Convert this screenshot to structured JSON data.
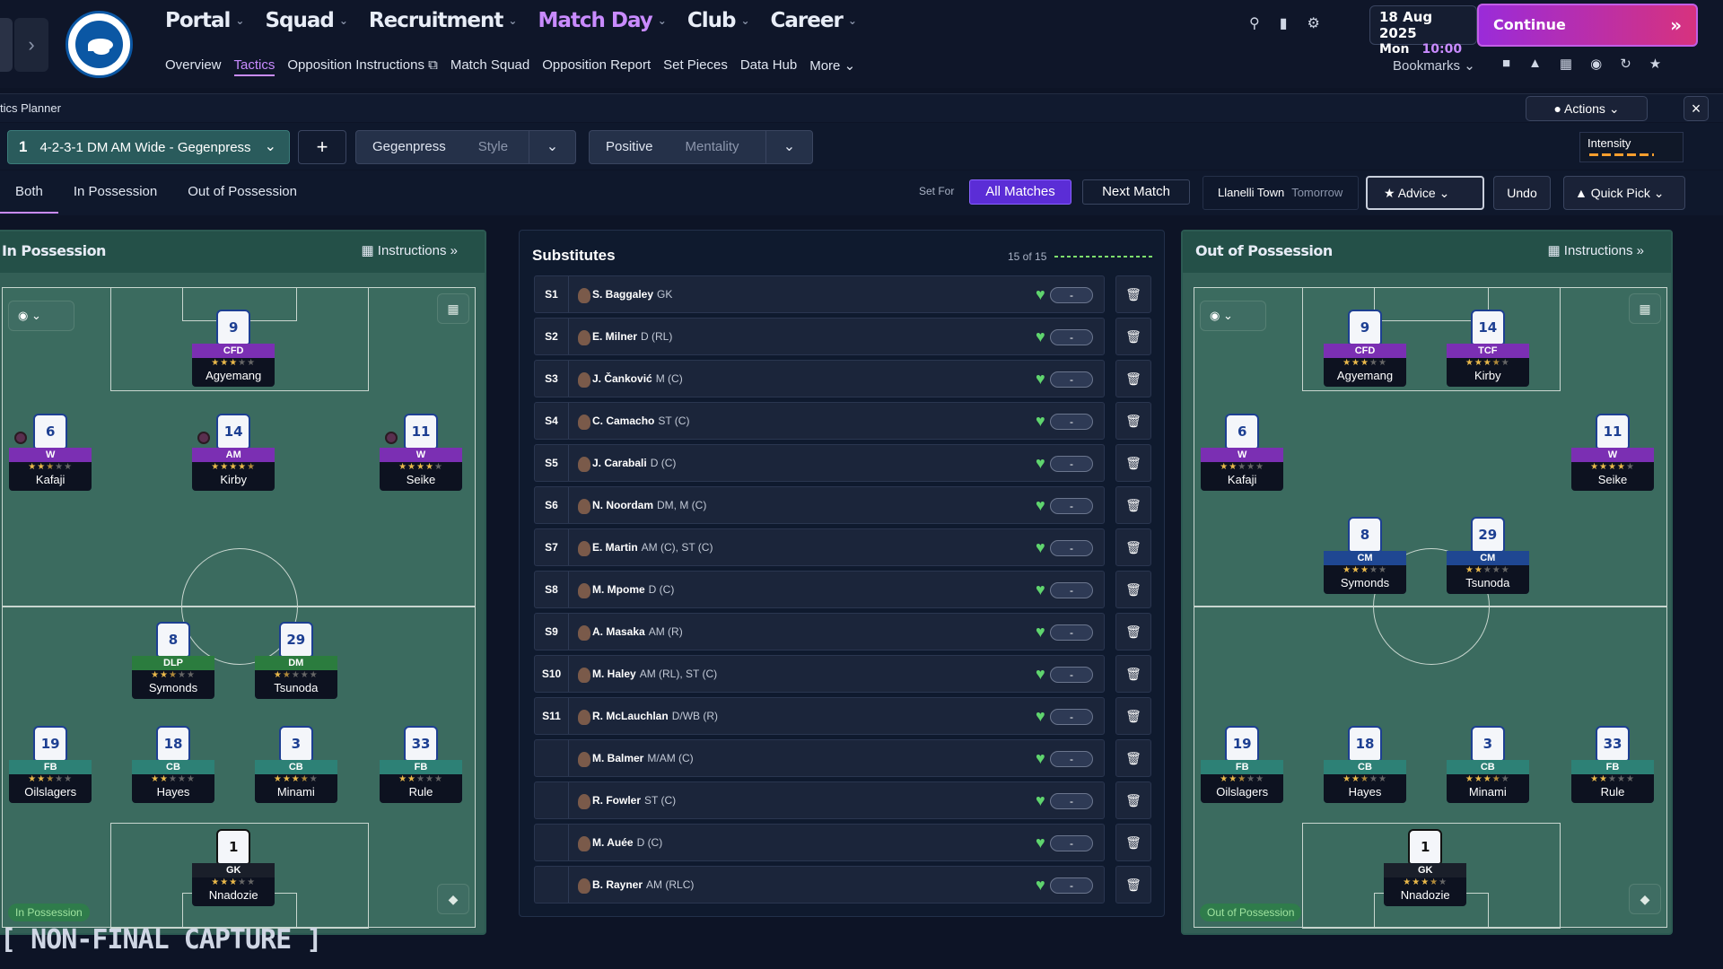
{
  "nav": {
    "items": [
      {
        "label": "Portal",
        "active": false
      },
      {
        "label": "Squad",
        "active": false
      },
      {
        "label": "Recruitment",
        "active": false
      },
      {
        "label": "Match Day",
        "active": true
      },
      {
        "label": "Club",
        "active": false
      },
      {
        "label": "Career",
        "active": false
      }
    ],
    "sub": [
      "Overview",
      "Tactics",
      "Opposition Instructions",
      "Match Squad",
      "Opposition Report",
      "Set Pieces",
      "Data Hub",
      "More"
    ],
    "active_sub": "Tactics",
    "date_line1": "18 Aug 2025",
    "date_day": "Mon",
    "date_time": "10:00",
    "continue_label": "Continue",
    "bookmarks_label": "Bookmarks"
  },
  "planner": {
    "title": "tics Planner",
    "actions_label": "Actions"
  },
  "tactic": {
    "slot": "1",
    "formation": "4-2-3-1 DM AM Wide - Gegenpress",
    "style_value": "Gegenpress",
    "style_label": "Style",
    "mentality_value": "Positive",
    "mentality_label": "Mentality",
    "intensity_label": "Intensity"
  },
  "filters": {
    "tabs": [
      "Both",
      "In Possession",
      "Out of Possession"
    ],
    "active_tab": "Both",
    "set_for_label": "Set For",
    "all_matches": "All Matches",
    "next_match": "Next Match",
    "opponent": "Llanelli Town",
    "opponent_when": "Tomorrow",
    "advice": "Advice",
    "undo": "Undo",
    "quick_pick": "Quick Pick"
  },
  "in_possession": {
    "title": "In Possession",
    "instructions": "Instructions",
    "tag": "In Possession",
    "players": [
      {
        "num": "9",
        "role": "CFD",
        "stars": 3,
        "name": "Agyemang",
        "cls": "att"
      },
      {
        "num": "6",
        "role": "W",
        "stars": 2.5,
        "name": "Kafaji",
        "cls": "att"
      },
      {
        "num": "14",
        "role": "AM",
        "stars": 4.5,
        "name": "Kirby",
        "cls": "att"
      },
      {
        "num": "11",
        "role": "W",
        "stars": 4,
        "name": "Seike",
        "cls": "att"
      },
      {
        "num": "8",
        "role": "DLP",
        "stars": 2.5,
        "name": "Symonds",
        "cls": "mid"
      },
      {
        "num": "29",
        "role": "DM",
        "stars": 1.5,
        "name": "Tsunoda",
        "cls": "mid"
      },
      {
        "num": "19",
        "role": "FB",
        "stars": 2.5,
        "name": "Oilslagers",
        "cls": "def"
      },
      {
        "num": "18",
        "role": "CB",
        "stars": 2,
        "name": "Hayes",
        "cls": "def"
      },
      {
        "num": "3",
        "role": "CB",
        "stars": 3.5,
        "name": "Minami",
        "cls": "def"
      },
      {
        "num": "33",
        "role": "FB",
        "stars": 2,
        "name": "Rule",
        "cls": "def"
      },
      {
        "num": "1",
        "role": "GK",
        "stars": 3,
        "name": "Nnadozie",
        "cls": "gk"
      }
    ]
  },
  "out_of_possession": {
    "title": "Out of Possession",
    "instructions": "Instructions",
    "tag": "Out of Possession",
    "players": [
      {
        "num": "9",
        "role": "CFD",
        "stars": 3,
        "name": "Agyemang",
        "cls": "att"
      },
      {
        "num": "14",
        "role": "TCF",
        "stars": 3.5,
        "name": "Kirby",
        "cls": "att"
      },
      {
        "num": "6",
        "role": "W",
        "stars": 2,
        "name": "Kafaji",
        "cls": "att"
      },
      {
        "num": "11",
        "role": "W",
        "stars": 4,
        "name": "Seike",
        "cls": "att"
      },
      {
        "num": "8",
        "role": "CM",
        "stars": 3,
        "name": "Symonds",
        "cls": "cm"
      },
      {
        "num": "29",
        "role": "CM",
        "stars": 2,
        "name": "Tsunoda",
        "cls": "cm"
      },
      {
        "num": "19",
        "role": "FB",
        "stars": 2.5,
        "name": "Oilslagers",
        "cls": "def"
      },
      {
        "num": "18",
        "role": "CB",
        "stars": 2.5,
        "name": "Hayes",
        "cls": "def"
      },
      {
        "num": "3",
        "role": "CB",
        "stars": 3.5,
        "name": "Minami",
        "cls": "def"
      },
      {
        "num": "33",
        "role": "FB",
        "stars": 2,
        "name": "Rule",
        "cls": "def"
      },
      {
        "num": "1",
        "role": "GK",
        "stars": 3.5,
        "name": "Nnadozie",
        "cls": "gk"
      }
    ]
  },
  "substitutes": {
    "title": "Substitutes",
    "count": "15 of 15",
    "rows": [
      {
        "code": "S1",
        "name": "S. Baggaley",
        "pos": "GK",
        "value": "-"
      },
      {
        "code": "S2",
        "name": "E. Milner",
        "pos": "D (RL)",
        "value": "-"
      },
      {
        "code": "S3",
        "name": "J. Čanković",
        "pos": "M (C)",
        "value": "-"
      },
      {
        "code": "S4",
        "name": "C. Camacho",
        "pos": "ST (C)",
        "value": "-"
      },
      {
        "code": "S5",
        "name": "J. Carabali",
        "pos": "D (C)",
        "value": "-"
      },
      {
        "code": "S6",
        "name": "N. Noordam",
        "pos": "DM, M (C)",
        "value": "-"
      },
      {
        "code": "S7",
        "name": "E. Martin",
        "pos": "AM (C), ST (C)",
        "value": "-"
      },
      {
        "code": "S8",
        "name": "M. Mpome",
        "pos": "D (C)",
        "value": "-"
      },
      {
        "code": "S9",
        "name": "A. Masaka",
        "pos": "AM (R)",
        "value": "-"
      },
      {
        "code": "S10",
        "name": "M. Haley",
        "pos": "AM (RL), ST (C)",
        "value": "-"
      },
      {
        "code": "S11",
        "name": "R. McLauchlan",
        "pos": "D/WB (R)",
        "value": "-"
      },
      {
        "code": "",
        "name": "M. Balmer",
        "pos": "M/AM (C)",
        "value": "-"
      },
      {
        "code": "",
        "name": "R. Fowler",
        "pos": "ST (C)",
        "value": "-"
      },
      {
        "code": "",
        "name": "M. Auée",
        "pos": "D (C)",
        "value": "-"
      },
      {
        "code": "",
        "name": "B. Rayner",
        "pos": "AM (RLC)",
        "value": "-"
      }
    ]
  },
  "watermark": "[ NON-FINAL CAPTURE ]",
  "colors": {
    "accent": "#c98bff",
    "continue_from": "#9a2bd9",
    "continue_to": "#d7327e",
    "pitch": "#335f56"
  }
}
